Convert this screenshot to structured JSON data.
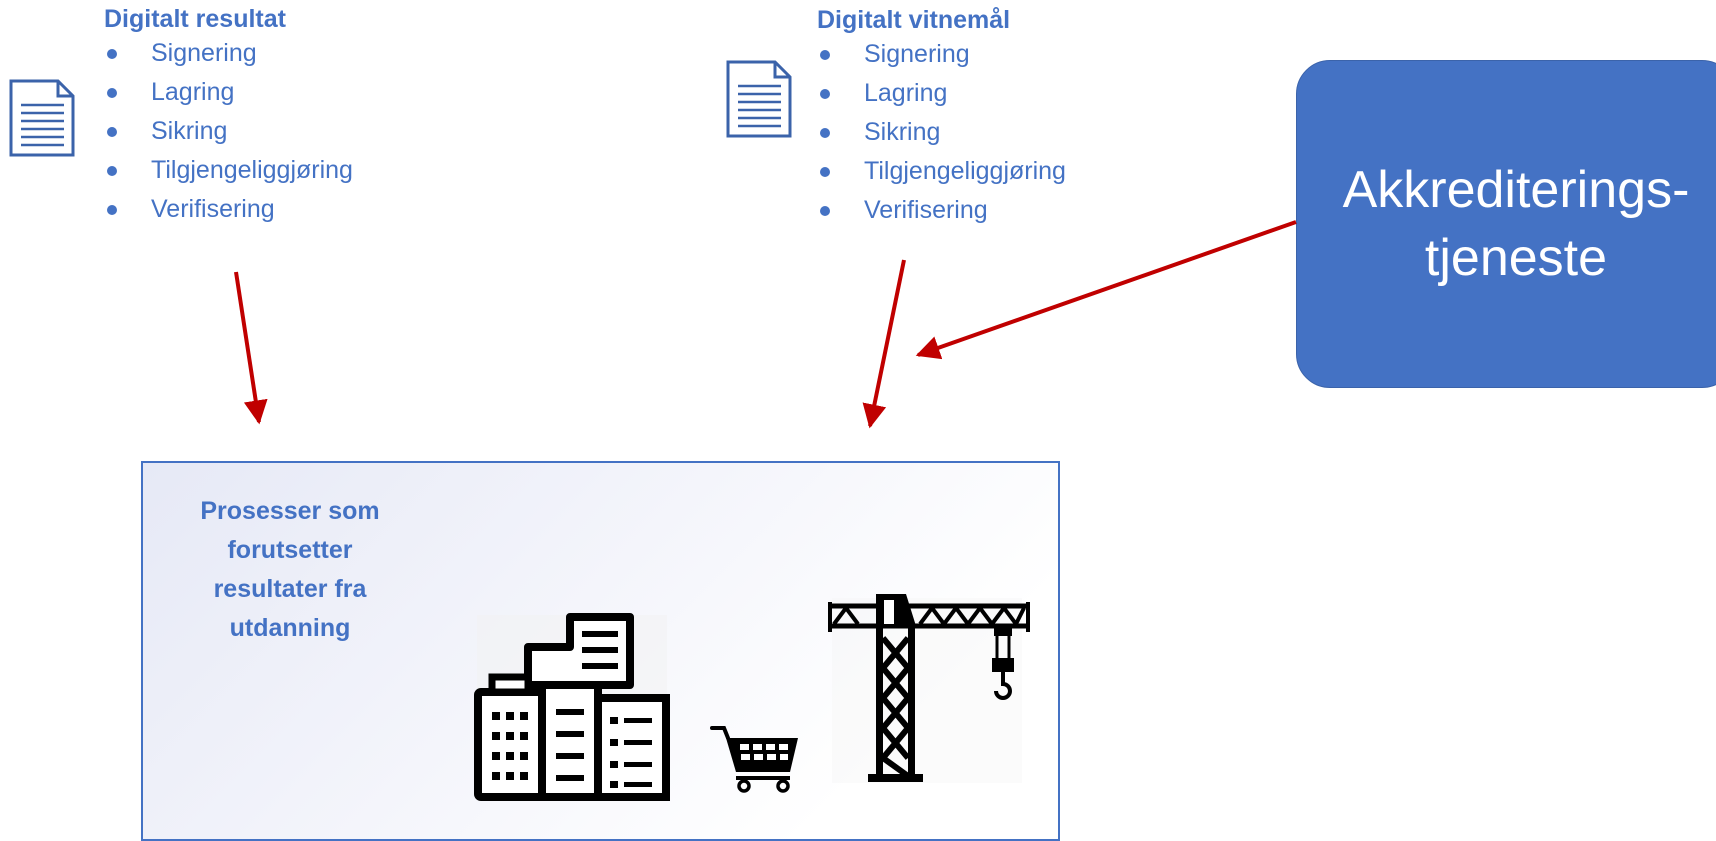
{
  "digital_result": {
    "title": "Digitalt resultat",
    "items": [
      "Signering",
      "Lagring",
      "Sikring",
      "Tilgjengeliggjøring",
      "Verifisering"
    ]
  },
  "digital_diploma": {
    "title": "Digitalt vitnemål",
    "items": [
      "Signering",
      "Lagring",
      "Sikring",
      "Tilgjengeliggjøring",
      "Verifisering"
    ]
  },
  "accreditation_service": {
    "label": "Akkrediterings-\ntjeneste"
  },
  "processes": {
    "title": "Prosesser som forutsetter resultater fra utdanning",
    "icons": [
      "buildings-icon",
      "shopping-cart-icon",
      "crane-icon"
    ]
  },
  "colors": {
    "accent": "#4472c4",
    "arrow": "#c00000",
    "icon": "#000000"
  }
}
